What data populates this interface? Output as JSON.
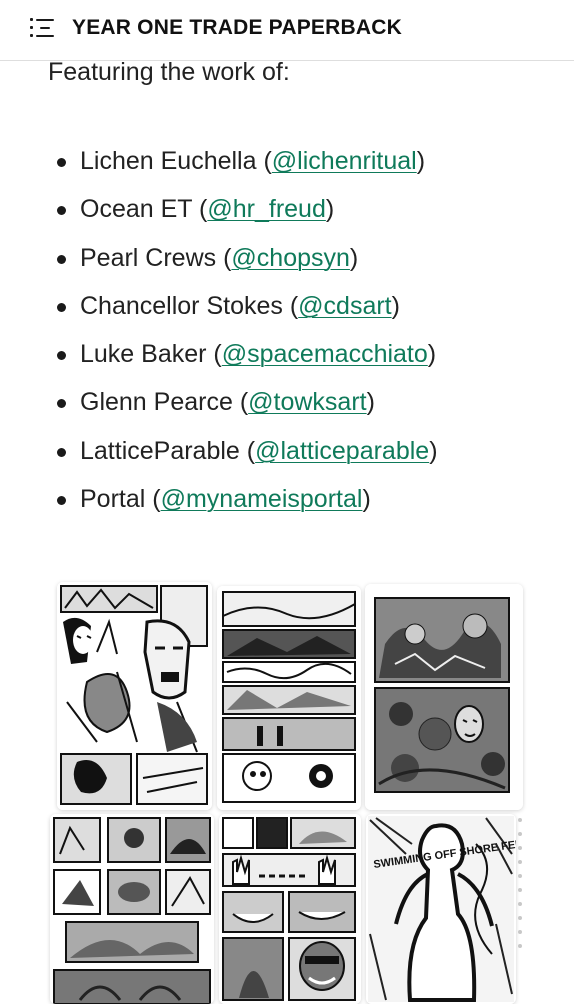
{
  "header": {
    "title": "YEAR ONE TRADE PAPERBACK",
    "menu_icon": "table-of-contents-icon"
  },
  "content": {
    "intro": "Featuring the work of:",
    "artists": [
      {
        "name": "Lichen Euchella (",
        "handle": "@lichenritual",
        "close": ")"
      },
      {
        "name": "Ocean ET (",
        "handle": "@hr_freud",
        "close": ")"
      },
      {
        "name": "Pearl Crews (",
        "handle": "@chopsyn",
        "close": ")"
      },
      {
        "name": "Chancellor Stokes (",
        "handle": "@cdsart",
        "close": ")"
      },
      {
        "name": "Luke Baker (",
        "handle": "@spacemacchiato",
        "close": ")"
      },
      {
        "name": "Glenn Pearce (",
        "handle": "@towksart",
        "close": ")"
      },
      {
        "name": "LatticeParable (",
        "handle": "@latticeparable",
        "close": ")"
      },
      {
        "name": "Portal (",
        "handle": "@mynameisportal",
        "close": ")"
      }
    ]
  },
  "colors": {
    "link": "#0f7a5a",
    "text": "#222222",
    "background": "#ffffff"
  },
  "gallery": {
    "images": [
      {
        "name": "comic-page-warrior-masks"
      },
      {
        "name": "comic-page-landscape-panels"
      },
      {
        "name": "comic-page-creature-battle"
      },
      {
        "name": "comic-page-grid-panels"
      },
      {
        "name": "comic-page-hands-faces"
      },
      {
        "name": "comic-page-scrawled-figure"
      }
    ],
    "scrawl_text": "SWIMMING OFF SHORE FEELS LIKE UNSURE"
  }
}
